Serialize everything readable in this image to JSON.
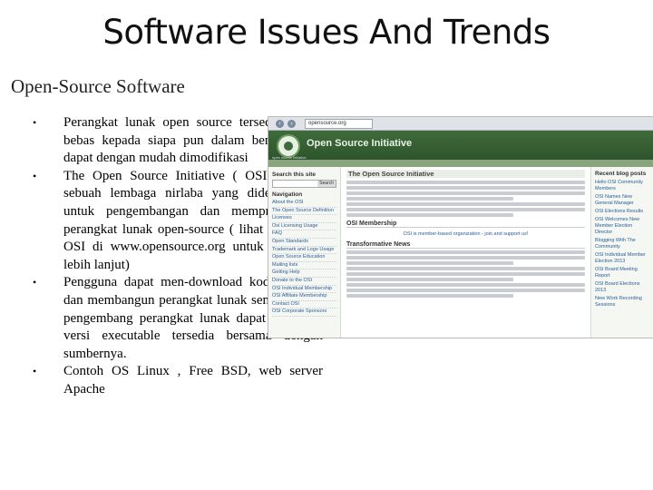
{
  "slide": {
    "title": "Software Issues And Trends",
    "subtitle": "Open-Source Software",
    "bullet_glyph": "•",
    "bullets": [
      "Perangkat lunak open source tersedia secara bebas kepada siapa pun dalam bentuk yang dapat dengan mudah dimodifikasi",
      "The Open Source Initiative ( OSI ) adalah sebuah lembaga nirlaba yang didedikasikan untuk pengembangan dan mempromosikan perangkat lunak open-source ( lihat situs Web OSI di www.opensource.org untuk informasi lebih lanjut)",
      "Pengguna dapat men-download kode sumber dan membangun perangkat lunak sendiri , atau pengembang perangkat lunak dapat membuat versi executable tersedia bersama dengan sumbernya.",
      "Contoh OS Linux , Free BSD, web server Apache"
    ]
  },
  "screenshot": {
    "url": "opensource.org",
    "site_title": "Open Source Initiative",
    "logo_caption": "open source initiative",
    "search_heading": "Search this site",
    "search_button": "Search",
    "nav_heading": "Navigation",
    "nav_links": [
      "About the OSI",
      "The Open Source Definition",
      "Licenses",
      "Osi Licensing Usage",
      "FAQ",
      "Open Standards",
      "Trademark and Logo Usage",
      "Open Source Education",
      "Mailing lists",
      "Getting Help",
      "Donate to the OSI",
      "OSI Individual Membership",
      "OSI Affiliate Membership",
      "Contact OSI",
      "OSI Corporate Sponsors"
    ],
    "page_heading": "The Open Source Initiative",
    "membership_heading": "OSI Membership",
    "membership_highlight": "OSI is member-based organization - join and support us!",
    "news_heading": "Transformative News",
    "sidebar_heading": "Recent blog posts",
    "recent_posts": [
      "Hello OSI Community Members",
      "OSI Names New General Manager",
      "OSI Elections Results",
      "OSI Welcomes New Member Election Director",
      "Blogging With The Community",
      "OSI Individual Member Election 2013",
      "OSI Board Meeting Report",
      "OSI Board Elections 2013",
      "New Work Recording Sessions"
    ]
  }
}
